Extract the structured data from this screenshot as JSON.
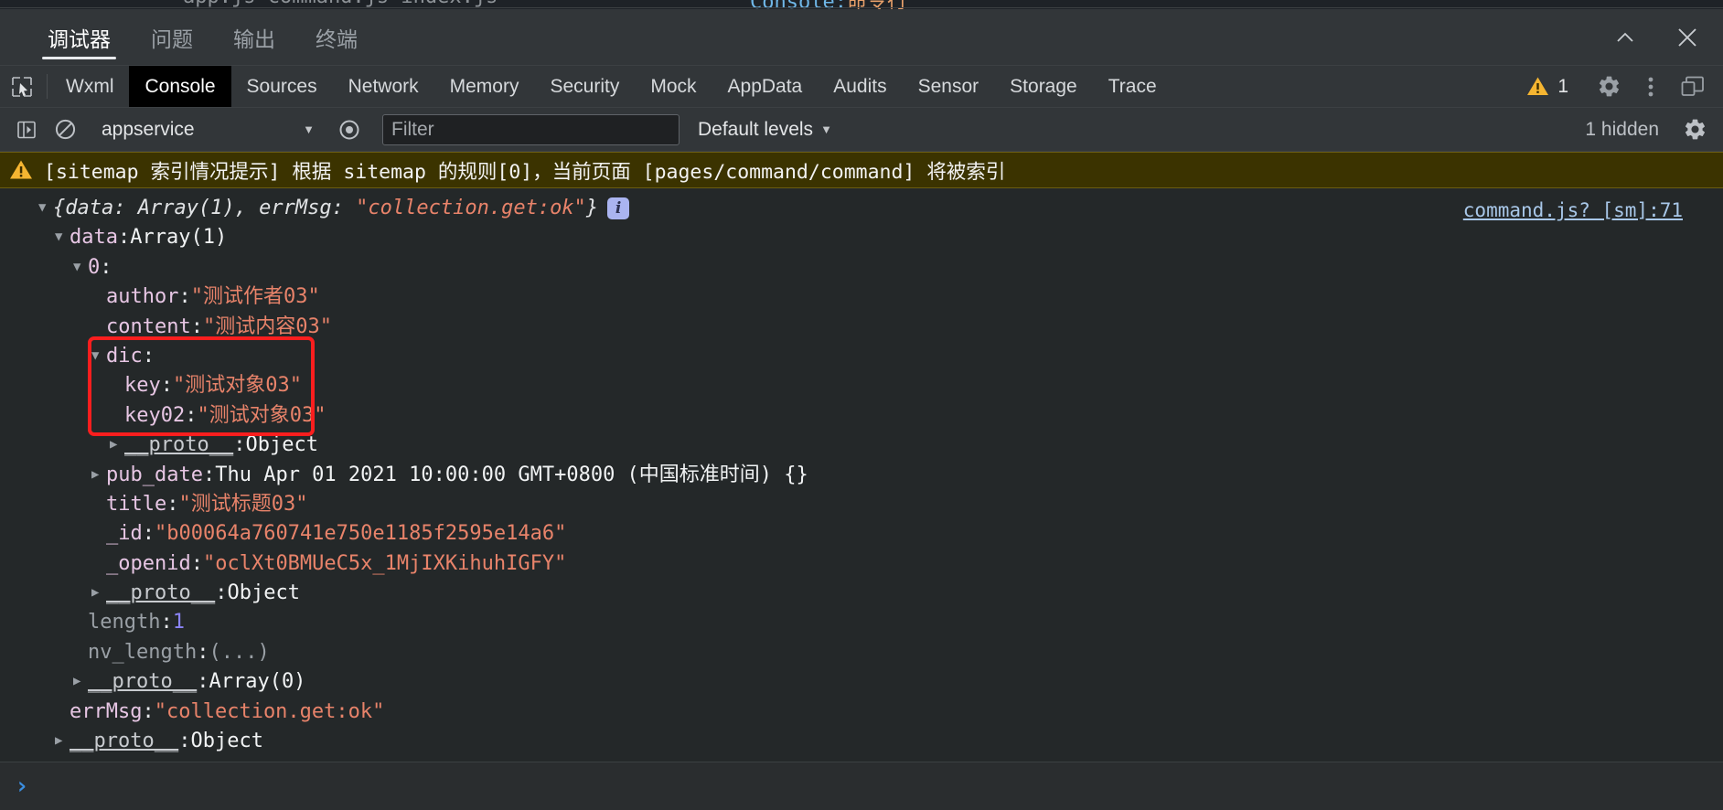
{
  "top_sliver": {
    "editor_tabs": "app.js    command.js    index.js",
    "title_left": "Console",
    "title_colon": ":",
    "title_right": "命令行"
  },
  "window": {
    "tabs": [
      {
        "label": "调试器",
        "active": true
      },
      {
        "label": "问题",
        "active": false
      },
      {
        "label": "输出",
        "active": false
      },
      {
        "label": "终端",
        "active": false
      }
    ],
    "minimize_label": "最小化",
    "close_label": "关闭"
  },
  "devtools": {
    "inspect_icon": "inspect-cursor-icon",
    "panels": [
      {
        "label": "Wxml",
        "active": false
      },
      {
        "label": "Console",
        "active": true
      },
      {
        "label": "Sources",
        "active": false
      },
      {
        "label": "Network",
        "active": false
      },
      {
        "label": "Memory",
        "active": false
      },
      {
        "label": "Security",
        "active": false
      },
      {
        "label": "Mock",
        "active": false
      },
      {
        "label": "AppData",
        "active": false
      },
      {
        "label": "Audits",
        "active": false
      },
      {
        "label": "Sensor",
        "active": false
      },
      {
        "label": "Storage",
        "active": false
      },
      {
        "label": "Trace",
        "active": false
      }
    ],
    "warning_count": "1",
    "settings_icon": "gear-icon",
    "more_icon": "kebab-menu-icon",
    "dock_icon": "dock-panel-icon"
  },
  "toolbar": {
    "execute_icon": "execute-step-icon",
    "clear_icon": "clear-console-icon",
    "context": "appservice",
    "context_caret": "▼",
    "eye_icon": "live-expression-icon",
    "filter_value": "",
    "filter_placeholder": "Filter",
    "levels": "Default levels",
    "levels_caret": "▼",
    "hidden_count": "1 hidden",
    "settings_icon": "console-settings-icon"
  },
  "warning_banner": {
    "icon": "warning-triangle-icon",
    "text": "[sitemap 索引情况提示] 根据 sitemap 的规则[0]，当前页面 [pages/command/command] 将被索引"
  },
  "log": {
    "source_link": "command.js? [sm]:71",
    "info_badge": "i",
    "preview": {
      "open": "{data: Array(1), errMsg: ",
      "string": "\"collection.get:ok\"",
      "close": "}"
    },
    "rows": [
      {
        "indent": 0,
        "arrow": "▼",
        "key": "data",
        "key_style": "prop",
        "sep": ": ",
        "value": "Array(1)",
        "value_style": "obj"
      },
      {
        "indent": 1,
        "arrow": "▼",
        "key": "0",
        "key_style": "prop",
        "sep": ":",
        "value": "",
        "value_style": "obj"
      },
      {
        "indent": 2,
        "arrow": "",
        "key": "author",
        "key_style": "prop",
        "sep": ": ",
        "value": "\"测试作者03\"",
        "value_style": "str"
      },
      {
        "indent": 2,
        "arrow": "",
        "key": "content",
        "key_style": "prop",
        "sep": ": ",
        "value": "\"测试内容03\"",
        "value_style": "str"
      },
      {
        "indent": 2,
        "arrow": "▼",
        "key": "dic",
        "key_style": "prop",
        "sep": ":",
        "value": "",
        "value_style": "obj"
      },
      {
        "indent": 3,
        "arrow": "",
        "key": "key",
        "key_style": "prop",
        "sep": ": ",
        "value": "\"测试对象03\"",
        "value_style": "str"
      },
      {
        "indent": 3,
        "arrow": "",
        "key": "key02",
        "key_style": "prop",
        "sep": ": ",
        "value": "\"测试对象03\"",
        "value_style": "str"
      },
      {
        "indent": 3,
        "arrow": "▶",
        "key": "__proto__",
        "key_style": "proto",
        "sep": ": ",
        "value": "Object",
        "value_style": "obj"
      },
      {
        "indent": 2,
        "arrow": "▶",
        "key": "pub_date",
        "key_style": "prop",
        "sep": ": ",
        "value": "Thu Apr 01 2021 10:00:00 GMT+0800 (中国标准时间) {}",
        "value_style": "plain"
      },
      {
        "indent": 2,
        "arrow": "",
        "key": "title",
        "key_style": "prop",
        "sep": ": ",
        "value": "\"测试标题03\"",
        "value_style": "str"
      },
      {
        "indent": 2,
        "arrow": "",
        "key": "_id",
        "key_style": "prop",
        "sep": ": ",
        "value": "\"b00064a760741e750e1185f2595e14a6\"",
        "value_style": "str"
      },
      {
        "indent": 2,
        "arrow": "",
        "key": "_openid",
        "key_style": "prop",
        "sep": ": ",
        "value": "\"oclXt0BMUeC5x_1MjIXKihuhIGFY\"",
        "value_style": "str"
      },
      {
        "indent": 2,
        "arrow": "▶",
        "key": "__proto__",
        "key_style": "proto",
        "sep": ": ",
        "value": "Object",
        "value_style": "obj"
      },
      {
        "indent": 1,
        "arrow": "",
        "key": "length",
        "key_style": "dim",
        "sep": ": ",
        "value": "1",
        "value_style": "num"
      },
      {
        "indent": 1,
        "arrow": "",
        "key": "nv_length",
        "key_style": "dim",
        "sep": ": ",
        "value": "(...)",
        "value_style": "dim"
      },
      {
        "indent": 1,
        "arrow": "▶",
        "key": "__proto__",
        "key_style": "proto",
        "sep": ": ",
        "value": "Array(0)",
        "value_style": "obj"
      },
      {
        "indent": 0,
        "arrow": "",
        "key": "errMsg",
        "key_style": "prop",
        "sep": ": ",
        "value": "\"collection.get:ok\"",
        "value_style": "str"
      },
      {
        "indent": 0,
        "arrow": "▶",
        "key": "__proto__",
        "key_style": "proto",
        "sep": ": ",
        "value": "Object",
        "value_style": "obj"
      }
    ]
  },
  "annotation": {
    "type": "red-rectangle",
    "color": "#fa1e1e",
    "covers": "dic object with key and key02 entries"
  },
  "prompt": {
    "chevron": "›",
    "value": "",
    "placeholder": ""
  }
}
